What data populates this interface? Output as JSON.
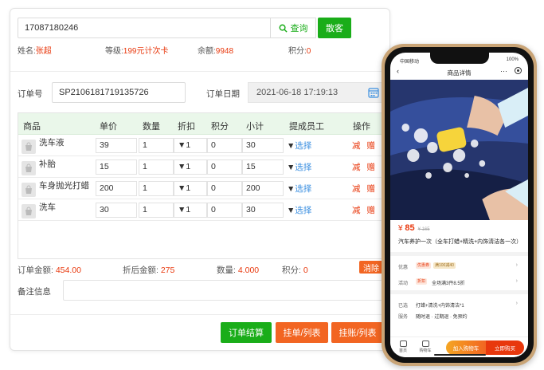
{
  "search": {
    "value": "17087180246",
    "query_label": "查询",
    "guest_label": "散客"
  },
  "member": {
    "name_label": "姓名:",
    "name": "张超",
    "level_label": "等级:",
    "level": "199元计次卡",
    "balance_label": "余额:",
    "balance": "9948",
    "points_label": "积分:",
    "points": "0"
  },
  "order": {
    "no_label": "订单号",
    "no": "SP2106181719135726",
    "date_label": "订单日期",
    "date": "2021-06-18 17:19:13"
  },
  "table": {
    "headers": [
      "商品",
      "单价",
      "数量",
      "折扣",
      "积分",
      "小计",
      "提成员工",
      "操作"
    ],
    "rows": [
      {
        "name": "洗车液",
        "price": "39",
        "qty": "1",
        "discount": "▼1",
        "points": "0",
        "subtotal": "30",
        "staff_arrow": "▼",
        "staff": "选择",
        "op_minus": "减",
        "op_gift": "赠"
      },
      {
        "name": "补胎",
        "price": "15",
        "qty": "1",
        "discount": "▼1",
        "points": "0",
        "subtotal": "15",
        "staff_arrow": "▼",
        "staff": "选择",
        "op_minus": "减",
        "op_gift": "赠"
      },
      {
        "name": "车身抛光打蜡",
        "price": "200",
        "qty": "1",
        "discount": "▼1",
        "points": "0",
        "subtotal": "200",
        "staff_arrow": "▼",
        "staff": "选择",
        "op_minus": "减",
        "op_gift": "赠"
      },
      {
        "name": "洗车",
        "price": "30",
        "qty": "1",
        "discount": "▼1",
        "points": "0",
        "subtotal": "30",
        "staff_arrow": "▼",
        "staff": "选择",
        "op_minus": "减",
        "op_gift": "赠"
      }
    ]
  },
  "summary": {
    "total_label": "订单金额:",
    "total": "454.00",
    "after_label": "折后金额:",
    "after": "275",
    "qty_label": "数量:",
    "qty": "4.000",
    "points_label": "积分:",
    "points": "0",
    "clear_label": "消除"
  },
  "remark": {
    "label": "备注信息"
  },
  "actions": {
    "checkout": "订单结算",
    "hang_list": "挂单/列表",
    "credit_list": "挂账/列表"
  },
  "phone": {
    "status_left": "中国移动",
    "status_right": "100%",
    "nav_title": "商品详情",
    "price_symbol": "¥",
    "price": "85",
    "old_price": "¥ 165",
    "product_title": "汽车养护一次（全车打蜡+精洗+内饰清洁各一次）",
    "promo_label": "优惠",
    "promo_tag1": "优惠券",
    "promo_tag2": "满100减40",
    "activity_label": "活动",
    "activity_tag": "折扣",
    "activity_text": "全场满3件8.5折",
    "selected_label": "已选",
    "selected_text": "打蜡+清洗+内饰清洁*1",
    "service_label": "服务",
    "service_text": "随时退 · 过期退 · 免预约",
    "home_label": "首页",
    "cart_label": "购物车",
    "add_cart": "加入购物车",
    "buy_now": "立即购买",
    "colors": {
      "accent": "#e8380d",
      "green": "#1aad19",
      "orange": "#f26522"
    }
  }
}
